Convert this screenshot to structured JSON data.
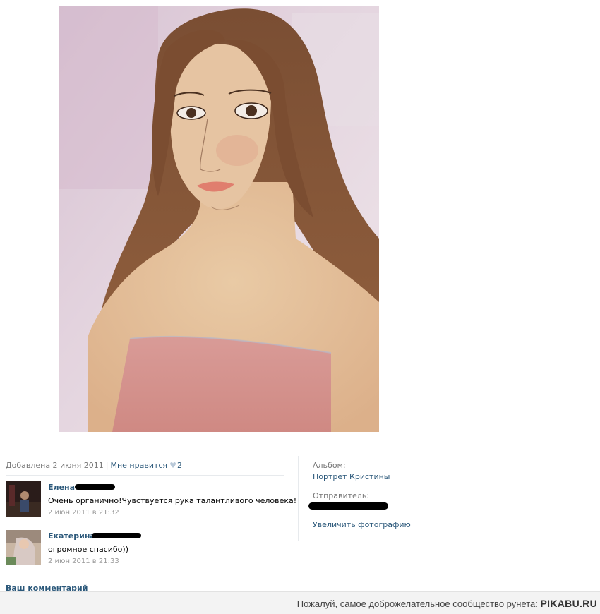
{
  "photo": {
    "alt": "portrait drawing"
  },
  "meta": {
    "added": "Добавлена 2 июня 2011",
    "separator": "|",
    "like_label": "Мне нравится",
    "like_icon": "heart-icon",
    "like_count": "2"
  },
  "comments": [
    {
      "author": "Елена",
      "text": "Очень органично!Чувствуется рука талантливого человека!",
      "date": "2 июн 2011 в 21:32"
    },
    {
      "author": "Екатерина",
      "text": "огромное спасибо))",
      "date": "2 июн 2011 в 21:33"
    }
  ],
  "your_comment_label": "Ваш комментарий",
  "sidebar": {
    "album_label": "Альбом:",
    "album_link": "Портрет Кристины",
    "sender_label": "Отправитель:",
    "zoom_link": "Увеличить фотографию"
  },
  "footer": {
    "slogan": "Пожалуй, самое доброжелательное сообщество рунета:",
    "brand": "PIKABU.RU"
  },
  "colors": {
    "link": "#2b587a",
    "muted": "#777777",
    "divider": "#e7eaed"
  }
}
